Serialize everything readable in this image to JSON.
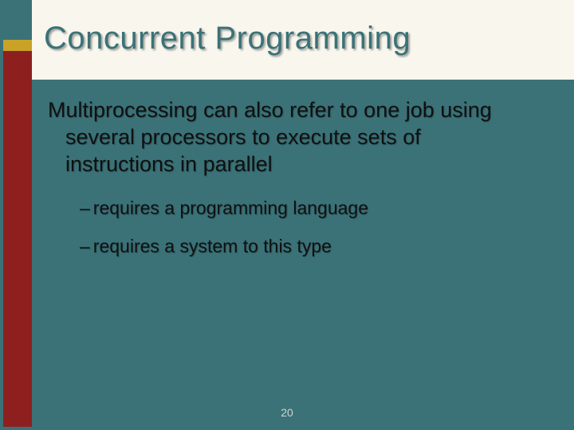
{
  "slide": {
    "title": "Concurrent Programming",
    "paragraph": "Multiprocessing can also refer to one job using several processors to execute sets of instructions in parallel",
    "bullets": [
      "requires a programming language",
      "requires a system to this type"
    ],
    "page_number": "20"
  }
}
